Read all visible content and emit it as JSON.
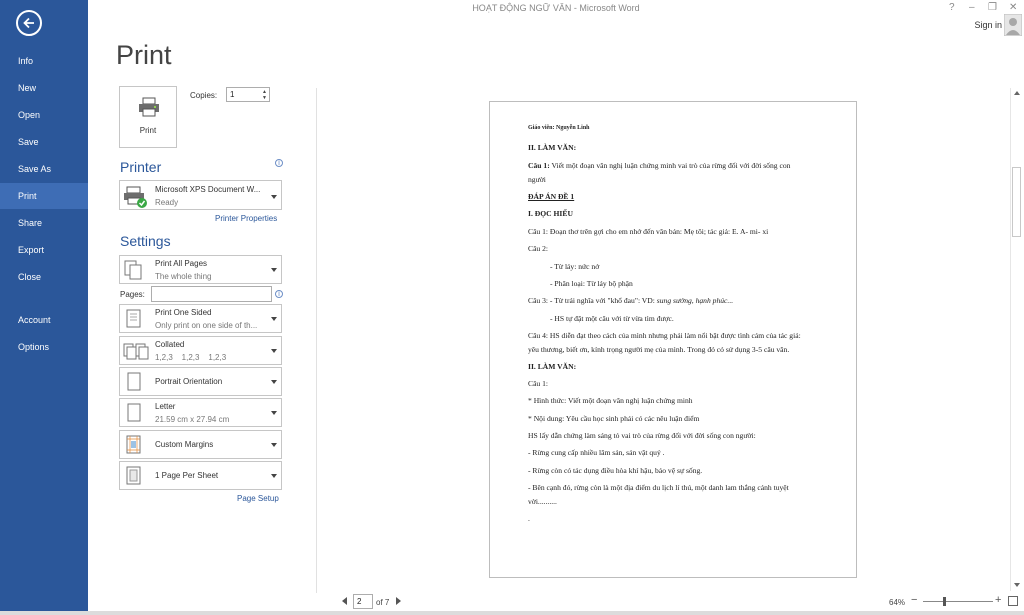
{
  "window": {
    "title": "HOẠT ĐỘNG NGỮ VĂN - Microsoft Word",
    "controls": [
      "?",
      "–",
      "❐",
      "✕"
    ],
    "sign_in": "Sign in"
  },
  "nav": {
    "items": [
      "Info",
      "New",
      "Open",
      "Save",
      "Save As",
      "Print",
      "Share",
      "Export",
      "Close",
      "Account",
      "Options"
    ],
    "active": "Print"
  },
  "print": {
    "heading": "Print",
    "button_label": "Print",
    "copies_label": "Copies:",
    "copies_value": "1"
  },
  "printer": {
    "heading": "Printer",
    "name": "Microsoft XPS Document W...",
    "status": "Ready",
    "properties_link": "Printer Properties"
  },
  "settings": {
    "heading": "Settings",
    "pages_label": "Pages:",
    "pages_value": "",
    "print_range": {
      "title": "Print All Pages",
      "subtitle": "The whole thing"
    },
    "sides": {
      "title": "Print One Sided",
      "subtitle": "Only print on one side of th..."
    },
    "collation": {
      "title": "Collated",
      "subtitle": "1,2,3    1,2,3    1,2,3"
    },
    "orientation": {
      "title": "Portrait Orientation"
    },
    "paper": {
      "title": "Letter",
      "subtitle": "21.59 cm x 27.94 cm"
    },
    "margins": {
      "title": "Custom Margins"
    },
    "per_sheet": {
      "title": "1 Page Per Sheet"
    },
    "page_setup_link": "Page Setup"
  },
  "preview": {
    "current_page": "2",
    "of_pages": "of 7",
    "zoom": "64%",
    "zoom_level_fraction": 0.3,
    "lines": [
      {
        "text": "Giáo viên: Nguyễn Linh",
        "style": "b small"
      },
      {
        "text": "II. LÀM VĂN:",
        "style": "b"
      },
      {
        "text": "Câu 1: Viết một đoạn văn nghị luận chứng minh vai trò của rừng đối với đời sống con",
        "style": "lead-b",
        "lead": "Câu 1:"
      },
      {
        "text": "người",
        "style": ""
      },
      {
        "text": "ĐÁP ÁN ĐỀ 1",
        "style": "b u"
      },
      {
        "text": "I. ĐỌC HIỂU",
        "style": "b"
      },
      {
        "text": "Câu 1: Đoạn thơ trên gợi cho em nhớ đến văn bản: Mẹ tôi; tác giả: E. A- mi- xi",
        "style": ""
      },
      {
        "text": "Câu 2:",
        "style": ""
      },
      {
        "text": "-      Từ láy: nức nở",
        "style": "indent"
      },
      {
        "text": "-      Phân loại: Từ láy bộ phận",
        "style": "indent"
      },
      {
        "text": "Câu 3: - Từ trái nghĩa với \"khổ đau\": VD: sung sướng, hạnh phúc...",
        "style": "tail-i",
        "tail": "sung sướng, hạnh phúc..."
      },
      {
        "text": "-      HS tự đặt một câu với từ vừa tìm được.",
        "style": "indent"
      },
      {
        "text": "Câu 4:  HS diễn đạt theo cách của mình nhưng phải làm nổi bật được tình cảm của tác giả:",
        "style": ""
      },
      {
        "text": "yêu thương, biết ơn, kính trọng người mẹ của mình. Trong đó có sử dụng 3-5 câu văn.",
        "style": ""
      },
      {
        "text": "II. LÀM VĂN:",
        "style": "b"
      },
      {
        "text": "Câu 1:",
        "style": ""
      },
      {
        "text": "* Hình thức:  Viết một đoạn văn nghị luận chứng minh",
        "style": ""
      },
      {
        "text": "* Nội dung: Yêu cầu học sinh phải có các nêu luận điểm",
        "style": ""
      },
      {
        "text": "HS lấy dẫn chứng làm sáng tỏ vai trò của rừng đối với đời sống con người:",
        "style": ""
      },
      {
        "text": "- Rừng cung cấp nhiều lâm sản, sản vật quý .",
        "style": ""
      },
      {
        "text": "- Rừng còn có tác dụng điều hòa khí hậu, bảo vệ sự sống.",
        "style": ""
      },
      {
        "text": "- Bên cạnh đó, rừng còn là một địa điểm du lịch lí thú, một danh lam thắng cảnh tuyệt",
        "style": ""
      },
      {
        "text": "vời..........",
        "style": ""
      },
      {
        "text": ".",
        "style": ""
      }
    ]
  }
}
